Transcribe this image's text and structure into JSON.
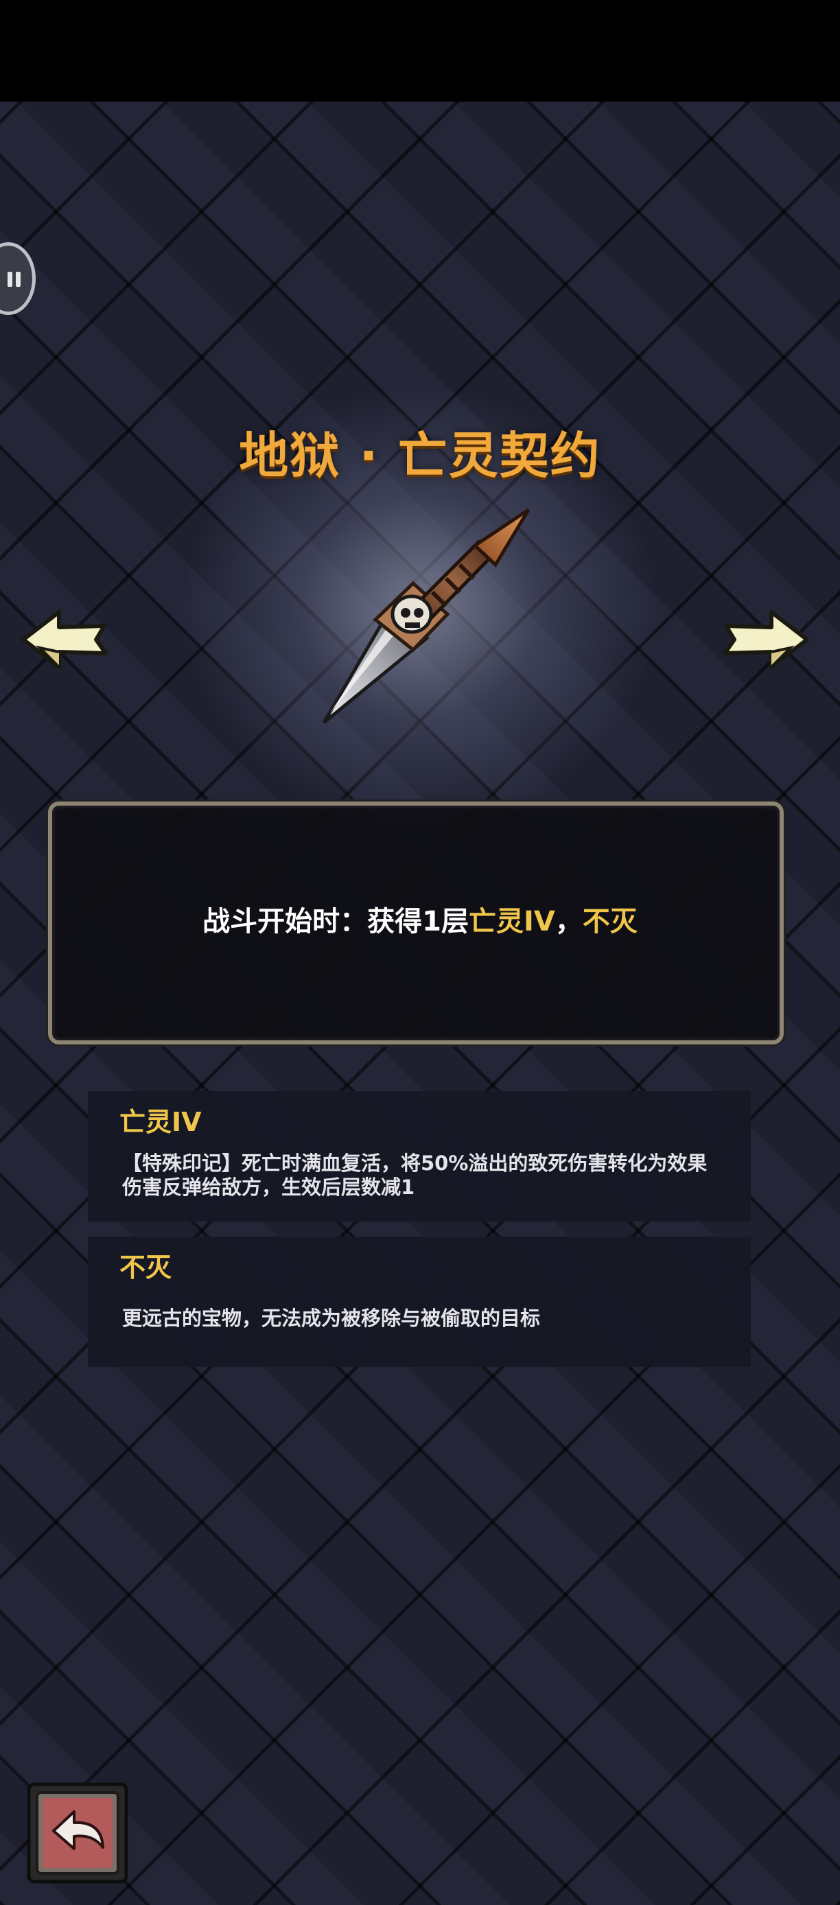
{
  "header": {
    "title": "地狱 · 亡灵契约"
  },
  "relic": {
    "icon": "skull-dagger-icon"
  },
  "description": {
    "prefix": "战斗开始时：获得1层",
    "keyword_1": "亡灵IV",
    "separator": "，",
    "keyword_2": "不灭"
  },
  "keywords": [
    {
      "title": "亡灵IV",
      "text": "【特殊印记】死亡时满血复活，将50%溢出的致死伤害转化为效果伤害反弹给敌方，生效后层数减1"
    },
    {
      "title": "不灭",
      "text": "更远古的宝物，无法成为被移除与被偷取的目标"
    }
  ],
  "colors": {
    "title": "#f2a93b",
    "keyword": "#f0c64a",
    "panel_border": "#8e8575",
    "back_button": "#b35a5a"
  },
  "icons": {
    "previous": "arrow-left-icon",
    "next": "arrow-right-icon",
    "back": "return-arrow-icon",
    "pause": "pause-icon"
  }
}
